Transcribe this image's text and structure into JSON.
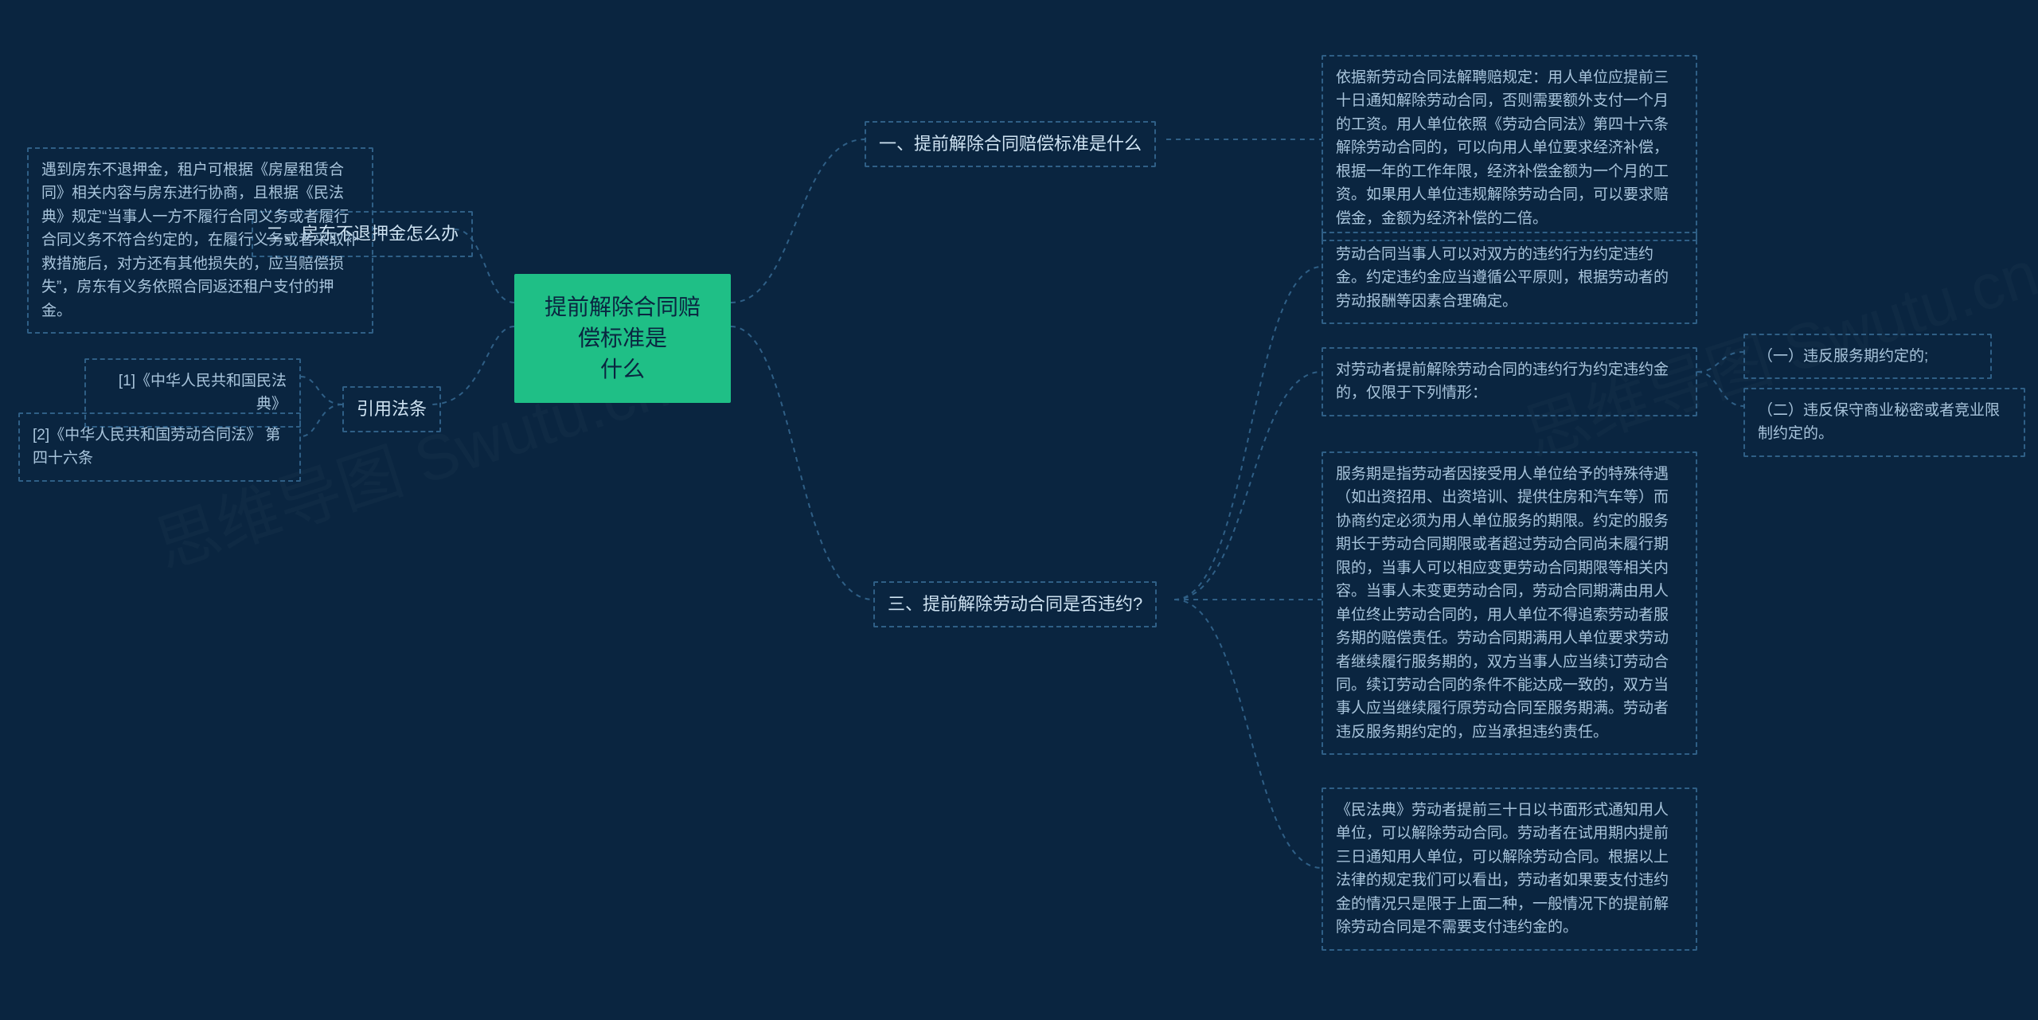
{
  "root": {
    "line1": "提前解除合同赔偿标准是",
    "line2": "什么"
  },
  "right": {
    "branch1": {
      "label": "一、提前解除合同赔偿标准是什么",
      "leaf": "依据新劳动合同法解聘赔规定：用人单位应提前三十日通知解除劳动合同，否则需要额外支付一个月的工资。用人单位依照《劳动合同法》第四十六条解除劳动合同的，可以向用人单位要求经济补偿，根据一年的工作年限，经济补偿金额为一个月的工资。如果用人单位违规解除劳动合同，可以要求赔偿金，金额为经济补偿的二倍。"
    },
    "branch2": {
      "label": "三、提前解除劳动合同是否违约?",
      "leaf1": "劳动合同当事人可以对双方的违约行为约定违约金。约定违约金应当遵循公平原则，根据劳动者的劳动报酬等因素合理确定。",
      "leaf2": "对劳动者提前解除劳动合同的违约行为约定违约金的，仅限于下列情形：",
      "leaf2_sub1": "（一）违反服务期约定的;",
      "leaf2_sub2": "（二）违反保守商业秘密或者竞业限制约定的。",
      "leaf3": "服务期是指劳动者因接受用人单位给予的特殊待遇（如出资招用、出资培训、提供住房和汽车等）而协商约定必须为用人单位服务的期限。约定的服务期长于劳动合同期限或者超过劳动合同尚未履行期限的，当事人可以相应变更劳动合同期限等相关内容。当事人未变更劳动合同，劳动合同期满由用人单位终止劳动合同的，用人单位不得追索劳动者服务期的赔偿责任。劳动合同期满用人单位要求劳动者继续履行服务期的，双方当事人应当续订劳动合同。续订劳动合同的条件不能达成一致的，双方当事人应当继续履行原劳动合同至服务期满。劳动者违反服务期约定的，应当承担违约责任。",
      "leaf4": "《民法典》劳动者提前三十日以书面形式通知用人单位，可以解除劳动合同。劳动者在试用期内提前三日通知用人单位，可以解除劳动合同。根据以上法律的规定我们可以看出，劳动者如果要支付违约金的情况只是限于上面二种，一般情况下的提前解除劳动合同是不需要支付违约金的。"
    }
  },
  "left": {
    "branch1": {
      "label": "二、房东不退押金怎么办",
      "leaf": "遇到房东不退押金，租户可根据《房屋租赁合同》相关内容与房东进行协商，且根据《民法典》规定“当事人一方不履行合同义务或者履行合同义务不符合约定的，在履行义务或者采取补救措施后，对方还有其他损失的，应当赔偿损失”，房东有义务依照合同返还租户支付的押金。"
    },
    "branch2": {
      "label": "引用法条",
      "leaf1": "[1]《中华人民共和国民法典》",
      "leaf2": "[2]《中华人民共和国劳动合同法》 第四十六条"
    }
  },
  "watermark": "思维导图 Swutu.cn"
}
